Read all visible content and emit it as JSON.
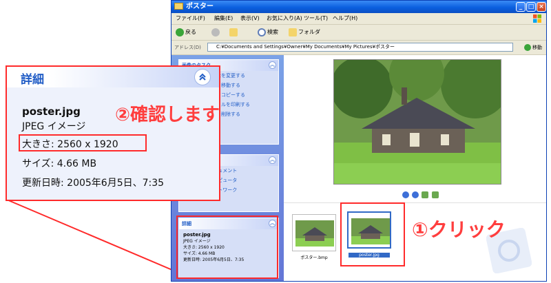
{
  "window": {
    "title": "ポスター",
    "menu": [
      "ファイル(F)",
      "編集(E)",
      "表示(V)",
      "お気に入り(A)",
      "ツール(T)",
      "ヘルプ(H)"
    ],
    "toolbar": {
      "back": "戻る",
      "search": "検索",
      "folders": "フォルダ"
    },
    "address_label": "アドレス(D)",
    "address_value": "C:¥Documents and Settings¥Owner¥My Documents¥My Pictures¥ポスター",
    "go_label": "移動"
  },
  "tasks": {
    "picture_tasks": {
      "header": "画像のタスク",
      "items": [
        "画像の表示を変更する",
        "ファイルを移動する",
        "ファイルをコピーする",
        "このファイルを印刷する",
        "ファイルを削除する"
      ]
    },
    "other": {
      "items": [
        "マイ ドキュメント",
        "マイ コンピュータ",
        "マイ ネットワーク"
      ]
    }
  },
  "details_panel": {
    "header": "詳細",
    "filename": "poster.jpg",
    "type": "JPEG イメージ",
    "dimensions": "大きさ: 2560 x 1920",
    "size": "サイズ: 4.66 MB",
    "modified": "更新日時: 2005年6月5日、7:35"
  },
  "filmstrip": {
    "thumbnails": [
      {
        "caption": "ポスター.bmp",
        "selected": false
      },
      {
        "caption": "poster.jpg",
        "selected": true
      }
    ]
  },
  "annotations": {
    "step1": "①クリック",
    "step2": "②確認します"
  },
  "colors": {
    "highlight": "#ff2a2a",
    "annotation_text": "#ff3e3e",
    "xp_blue": "#215dc6",
    "titlebar": "#0a5fdf"
  }
}
